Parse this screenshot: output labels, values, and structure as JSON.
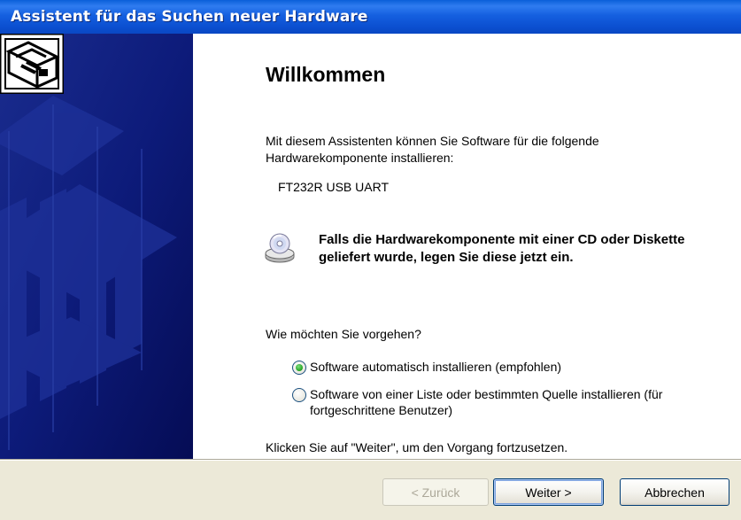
{
  "window": {
    "title": "Assistent für das Suchen neuer Hardware"
  },
  "page": {
    "heading": "Willkommen",
    "intro": "Mit diesem Assistenten können Sie Software für die folgende Hardwarekomponente installieren:",
    "device_name": "FT232R USB UART",
    "cd_note": "Falls die Hardwarekomponente mit einer CD oder Diskette geliefert wurde, legen Sie diese jetzt ein.",
    "question": "Wie möchten Sie vorgehen?",
    "options": [
      {
        "label": "Software automatisch installieren (empfohlen)",
        "selected": true
      },
      {
        "label": "Software von einer Liste oder bestimmten Quelle installieren (für fortgeschrittene Benutzer)",
        "selected": false
      }
    ],
    "continue_text": "Klicken Sie auf \"Weiter\", um den Vorgang fortzusetzen."
  },
  "buttons": {
    "back": "< Zurück",
    "next": "Weiter >",
    "cancel": "Abbrechen"
  },
  "icons": {
    "wizard": "hardware-wizard-icon",
    "cd": "cd-drive-icon"
  },
  "colors": {
    "title_bar": "#0A5FD9",
    "left_panel": "#0A1670",
    "radio_selected": "#21A121",
    "dialog_background": "#ECE9D8"
  }
}
